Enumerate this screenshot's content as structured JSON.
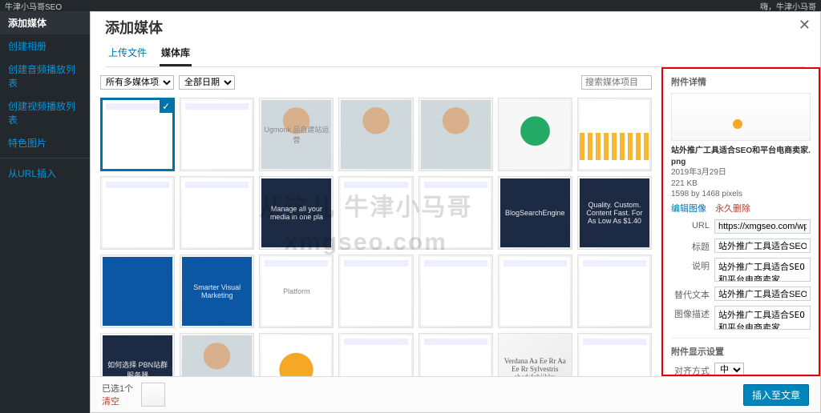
{
  "topbar": {
    "brand": "牛津小马哥SEO",
    "howdy": "嗨，牛津小马哥"
  },
  "wp_sidebar": {
    "items": [
      "添加媒体",
      "创建相册",
      "创建音频播放列表",
      "创建视频播放列表",
      "特色图片",
      "从URL插入"
    ]
  },
  "modal": {
    "title": "添加媒体",
    "tabs": {
      "upload": "上传文件",
      "library": "媒体库"
    },
    "filters": {
      "type": "所有多媒体项",
      "date": "全部日期"
    },
    "search_placeholder": "搜索媒体项目...",
    "watermark": {
      "line1": "从这儿  牛津小马哥",
      "line2": "xmgseo.com"
    },
    "thumbs": [
      {
        "label": "",
        "cls": "f-doc",
        "selected": true
      },
      {
        "label": "",
        "cls": "f-doc"
      },
      {
        "label": "Ugmonk 品自建站运营",
        "cls": "f-person"
      },
      {
        "label": "",
        "cls": "f-person"
      },
      {
        "label": "",
        "cls": "f-person"
      },
      {
        "label": "",
        "cls": "f-tee"
      },
      {
        "label": "",
        "cls": "f-chart"
      },
      {
        "label": "",
        "cls": "f-doc"
      },
      {
        "label": "",
        "cls": "f-doc"
      },
      {
        "label": "Manage all your media in one pla",
        "cls": "f-dark"
      },
      {
        "label": "",
        "cls": "f-doc"
      },
      {
        "label": "",
        "cls": "f-doc"
      },
      {
        "label": "BlogSearchEngine",
        "cls": "f-dark"
      },
      {
        "label": "Quality. Custom. Content Fast. For As Low As $1.40",
        "cls": "f-dark"
      },
      {
        "label": "",
        "cls": "f-blue"
      },
      {
        "label": "Smarter Visual Marketing",
        "cls": "f-blue"
      },
      {
        "label": "Platform",
        "cls": "f-doc"
      },
      {
        "label": "",
        "cls": "f-doc"
      },
      {
        "label": "",
        "cls": "f-doc"
      },
      {
        "label": "",
        "cls": "f-doc"
      },
      {
        "label": "",
        "cls": "f-doc"
      },
      {
        "label": "如何选择 PBN站群 服务器",
        "cls": "f-dark"
      },
      {
        "label": "",
        "cls": "f-person"
      },
      {
        "label": "",
        "cls": "f-orange"
      },
      {
        "label": "",
        "cls": "f-doc"
      },
      {
        "label": "",
        "cls": "f-doc"
      },
      {
        "label": "Verdana Aa Ee Rr Aa Ee Rr Sylvestris abcdefghijklm",
        "cls": "f-text"
      },
      {
        "label": "",
        "cls": "f-doc"
      }
    ]
  },
  "details": {
    "heading": "附件详情",
    "filename": "站外推广工具适合SEO和平台电商卖家.png",
    "date": "2019年3月29日",
    "size": "221 KB",
    "dims": "1598 by 1468 pixels",
    "edit_link": "编辑图像",
    "delete_link": "永久删除",
    "url_label": "URL",
    "url_value": "https://xmgseo.com/wp-content",
    "title_label": "标题",
    "title_value": "站外推广工具适合SEO和平台",
    "caption_label": "说明",
    "caption_value": "站外推广工具适合SEO和平台电商卖家",
    "alt_label": "替代文本",
    "alt_value": "站外推广工具适合SEO和平台",
    "desc_label": "图像描述",
    "desc_value": "站外推广工具适合SEO和平台电商卖家",
    "display_heading": "附件显示设置",
    "align_label": "对齐方式",
    "align_value": "中"
  },
  "footer": {
    "selected": "已选1个",
    "clear": "清空",
    "insert": "插入至文章"
  }
}
